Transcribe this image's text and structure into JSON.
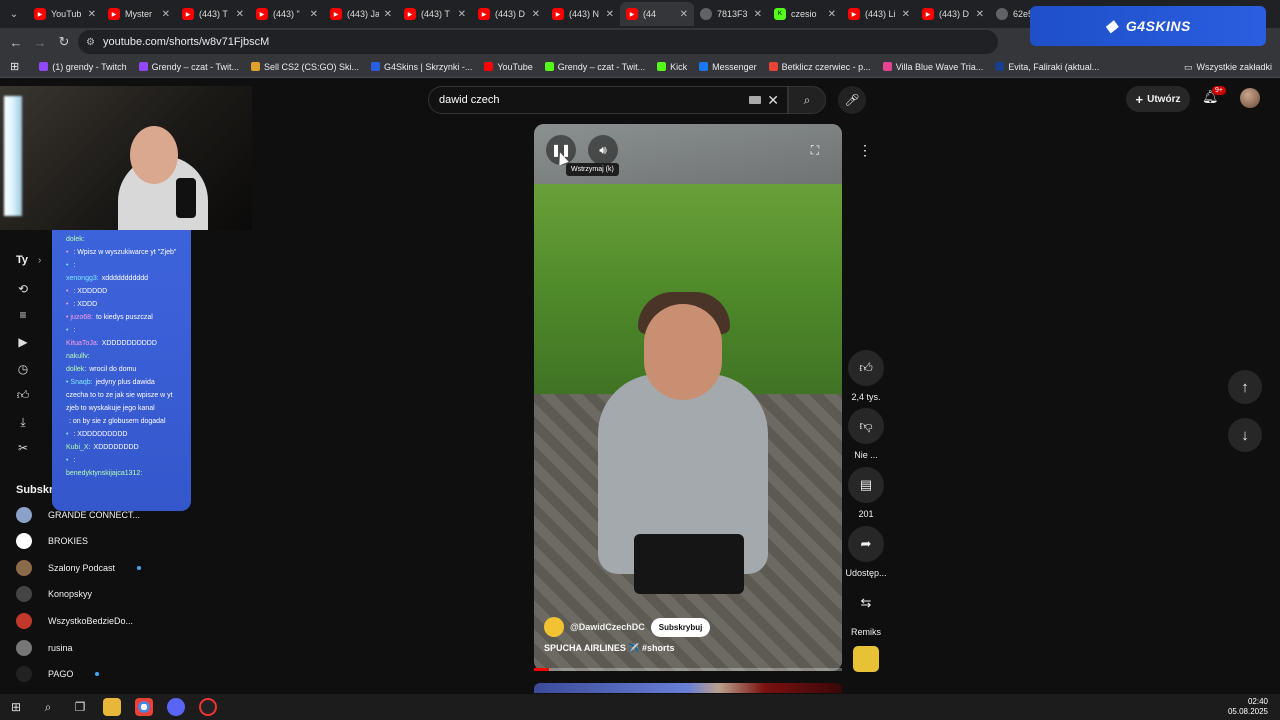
{
  "browser": {
    "tabs": [
      {
        "label": "YouTub",
        "icon": "youtube-icon",
        "active": false
      },
      {
        "label": "Myster",
        "icon": "youtube-icon",
        "active": false
      },
      {
        "label": "(443) T",
        "icon": "youtube-icon",
        "active": false
      },
      {
        "label": "(443) \"",
        "icon": "youtube-icon",
        "active": false
      },
      {
        "label": "(443) Ja",
        "icon": "youtube-icon",
        "active": false
      },
      {
        "label": "(443) T",
        "icon": "youtube-icon",
        "active": false
      },
      {
        "label": "(443) D",
        "icon": "youtube-icon",
        "active": false
      },
      {
        "label": "(443) N",
        "icon": "youtube-icon",
        "active": false
      },
      {
        "label": "(44",
        "icon": "youtube-icon",
        "active": true
      },
      {
        "label": "7813F3",
        "icon": "globe-icon",
        "active": false
      },
      {
        "label": "czesio",
        "icon": "kick-icon",
        "active": false
      },
      {
        "label": "(443) Li",
        "icon": "youtube-icon",
        "active": false
      },
      {
        "label": "(443) D",
        "icon": "youtube-icon",
        "active": false
      },
      {
        "label": "62e58",
        "icon": "globe-icon",
        "active": false
      }
    ],
    "url": "youtube.com/shorts/w8v71FjbscM",
    "overlay_brand": "G4SKINS",
    "bookmarks": [
      {
        "label": "(1) grendy - Twitch",
        "color": "#9146ff"
      },
      {
        "label": "Grendy – czat - Twit...",
        "color": "#9146ff"
      },
      {
        "label": "Sell CS2 (CS:GO) Ski...",
        "color": "#e0a030"
      },
      {
        "label": "G4Skins | Skrzynki -...",
        "color": "#2a5ee0"
      },
      {
        "label": "YouTube",
        "color": "#ff0000"
      },
      {
        "label": "Grendy – czat - Twit...",
        "color": "#53fc18"
      },
      {
        "label": "Kick",
        "color": "#53fc18"
      },
      {
        "label": "Messenger",
        "color": "#1877f2"
      },
      {
        "label": "Betklicz czerwiec - p...",
        "color": "#ea4335"
      },
      {
        "label": "Villa Blue Wave Tria...",
        "color": "#e84393"
      },
      {
        "label": "Evita, Faliraki (aktual...",
        "color": "#1a3e8a"
      }
    ],
    "bookmarks_all": "Wszystkie zakładki"
  },
  "youtube": {
    "search_value": "dawid czech",
    "create_label": "Utwórz",
    "notif_badge": "9+",
    "sidebar_you": "Ty",
    "subscriptions_title": "Subskry",
    "subscriptions": [
      {
        "name": "GRANDE CONNECT...",
        "live": false,
        "color": "#8aa2c8"
      },
      {
        "name": "BROKIES",
        "live": false,
        "color": "#ffffff"
      },
      {
        "name": "Szalony Podcast",
        "live": true,
        "color": "#8b6a4a"
      },
      {
        "name": "Konopskyy",
        "live": false,
        "color": "#444444"
      },
      {
        "name": "WszystkoBedzieDo...",
        "live": false,
        "color": "#c0392b"
      },
      {
        "name": "rusina",
        "live": false,
        "color": "#777777"
      },
      {
        "name": "PAGO",
        "live": true,
        "color": "#222222"
      }
    ],
    "video": {
      "pause_tooltip": "Wstrzymaj (k)",
      "channel": "@DawidCzechDC",
      "subscribe_label": "Subskrybuj",
      "caption": "SPUCHA AIRLINES ✈️ #shorts",
      "progress_percent": 5
    },
    "actions": {
      "likes": "2,4 tys.",
      "dislike": "Nie ...",
      "comments": "201",
      "share": "Udostęp...",
      "remix": "Remiks"
    }
  },
  "chat": [
    {
      "user": "dolek:",
      "text": "",
      "cls": "u3"
    },
    {
      "user": "• ",
      "text": ": Wpisz w wyszukiwarce yt \"Zjeb\"",
      "cls": "u2"
    },
    {
      "user": "• ",
      "text": ":",
      "cls": "u"
    },
    {
      "user": "xenongg3:",
      "text": "xddddddddddd",
      "cls": "u"
    },
    {
      "user": "• ",
      "text": ": XDDDDD",
      "cls": "u2"
    },
    {
      "user": "• ",
      "text": ": XDDD",
      "cls": "u2"
    },
    {
      "user": "• juzo68:",
      "text": "to kiedys puszczal",
      "cls": "u2"
    },
    {
      "user": "• ",
      "text": ":",
      "cls": "u"
    },
    {
      "user": "KituaToJa:",
      "text": "XDDDDDDDDDD",
      "cls": "u2"
    },
    {
      "user": "nakullv:",
      "text": "",
      "cls": "u3"
    },
    {
      "user": "dollek:",
      "text": "wrocil do domu",
      "cls": "u3"
    },
    {
      "user": "• Snaqb:",
      "text": "jedyny plus dawida czecha to to ze jak sie wpisze w yt zjeb to wyskakuje jego kanal",
      "cls": "u"
    },
    {
      "user": "",
      "text": ": on by sie z globusem dogadal",
      "cls": "u2"
    },
    {
      "user": "• ",
      "text": ": XDDDDDDDDD",
      "cls": "u"
    },
    {
      "user": "Kubi_X:",
      "text": "XDDDDDDDD",
      "cls": "u3"
    },
    {
      "user": "• ",
      "text": ":",
      "cls": "u"
    },
    {
      "user": "benedyktynskijajca1312:",
      "text": "",
      "cls": "u3"
    }
  ],
  "taskbar": {
    "time": "02:40",
    "date": "05.08.2025"
  }
}
